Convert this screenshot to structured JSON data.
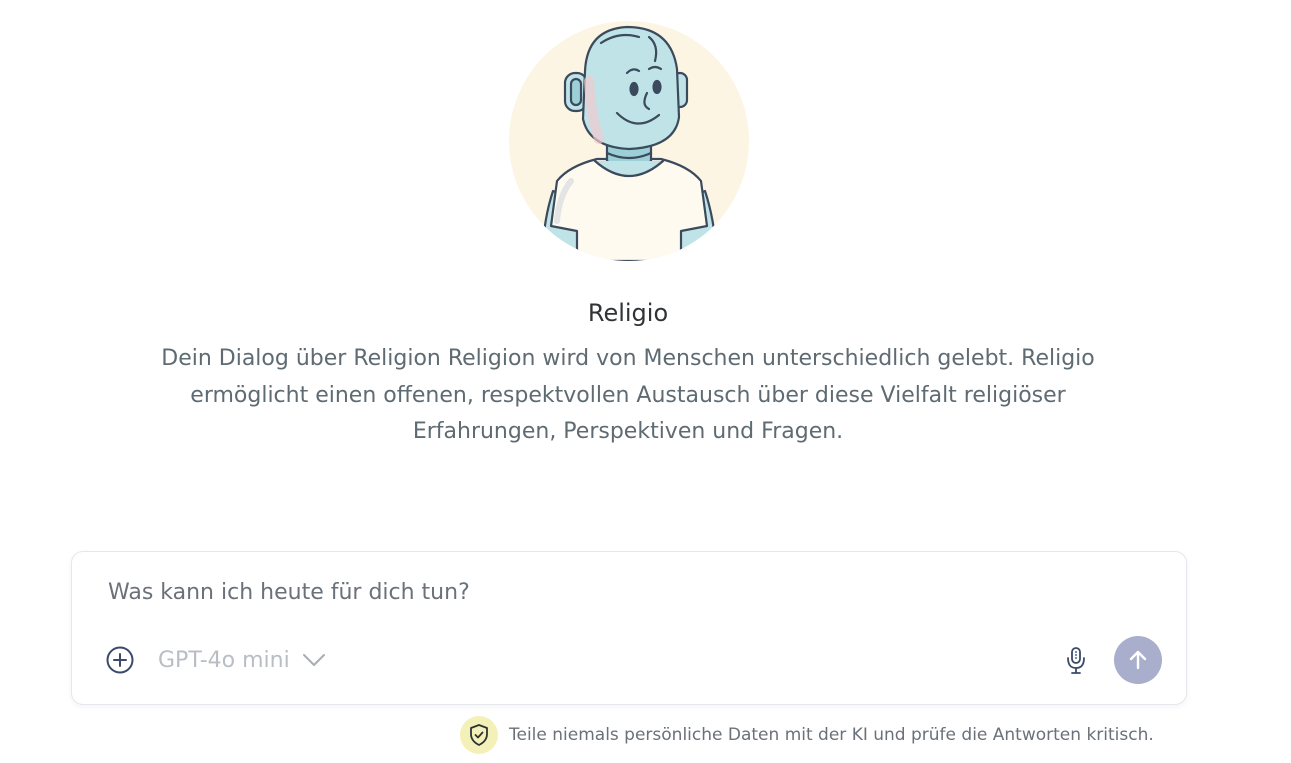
{
  "assistant": {
    "name": "Religio",
    "description": "Dein Dialog über Religion Religion wird von Menschen unterschiedlich gelebt. Religio ermöglicht einen offenen, respektvollen Austausch über diese Vielfalt religiöser Erfahrungen, Perspektiven und Fragen."
  },
  "composer": {
    "placeholder": "Was kann ich heute für dich tun?",
    "model": "GPT-4o mini",
    "icons": {
      "add": "plus-circle-icon",
      "model_dropdown": "chevron-down-icon",
      "microphone": "microphone-icon",
      "send": "arrow-up-icon"
    }
  },
  "disclaimer": {
    "text": "Teile niemals persönliche Daten mit der KI und prüfe die Antworten kritisch.",
    "icon": "shield-check-icon"
  },
  "colors": {
    "avatar_bg": "#fdf5e3",
    "send_button": "#a8aecb",
    "shield_badge": "#f3f0b8",
    "robot_skin": "#bfe3e6",
    "outline": "#3b4a5c"
  }
}
